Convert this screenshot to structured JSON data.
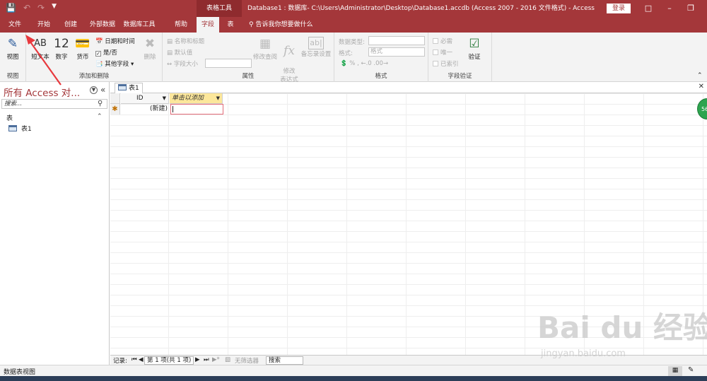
{
  "qat": {
    "save_icon": "save-icon",
    "undo_icon": "undo-icon",
    "redo_icon": "redo-icon",
    "customize_icon": "customize-icon"
  },
  "title": {
    "tool_context": "表格工具",
    "document": "Database1 : 数据库- C:\\Users\\Administrator\\Desktop\\Database1.accdb (Access 2007 - 2016 文件格式)  -  Access",
    "login": "登录"
  },
  "tabs": [
    {
      "label": "文件"
    },
    {
      "label": "开始"
    },
    {
      "label": "创建"
    },
    {
      "label": "外部数据"
    },
    {
      "label": "数据库工具"
    },
    {
      "label": "帮助"
    },
    {
      "label": "字段"
    },
    {
      "label": "表"
    }
  ],
  "tell_me": "告诉我你想要做什么",
  "ribbon": {
    "view": {
      "label": "视图",
      "group": "视图"
    },
    "add": {
      "group": "添加和删除",
      "short_text": "短文本",
      "short_text_icon": "AB",
      "number": "数字",
      "number_icon": "12",
      "currency": "货币",
      "datetime": "日期和时间",
      "yesno": "是/否",
      "more": "其他字段",
      "delete": "删除"
    },
    "props": {
      "group": "属性",
      "name_caption": "名称和标题",
      "default_value": "默认值",
      "field_size": "字段大小",
      "modify_lookup": "修改查阅",
      "modify_expr": "修改\n表达式",
      "memo": "备忘录设置"
    },
    "format": {
      "group": "格式",
      "datatype": "数据类型:",
      "format_label": "格式:",
      "format_value": "格式",
      "percent": "%",
      "comma": ","
    },
    "validation": {
      "group": "字段验证",
      "required": "必需",
      "unique": "唯一",
      "indexed": "已索引",
      "validate": "验证"
    }
  },
  "nav": {
    "title": "所有 Access 对...",
    "search_placeholder": "搜索...",
    "group": "表",
    "items": [
      {
        "label": "表1"
      }
    ]
  },
  "doc_tab": {
    "label": "表1"
  },
  "datasheet": {
    "columns": [
      {
        "label": "ID"
      },
      {
        "label": "单击以添加"
      }
    ],
    "new_row": "(新建)"
  },
  "record_nav": {
    "label": "记录:",
    "position": "第 1 项(共 1 项)",
    "filter": "无筛选器",
    "search": "搜索"
  },
  "status": {
    "text": "数据表视图"
  },
  "watermark": {
    "main": "Bai du 经验",
    "sub": "jingyan.baidu.com"
  },
  "badge": "56",
  "colors": {
    "accent": "#a4373a",
    "header_highlight": "#fce79b",
    "annotation_arrow": "#e8383d"
  }
}
